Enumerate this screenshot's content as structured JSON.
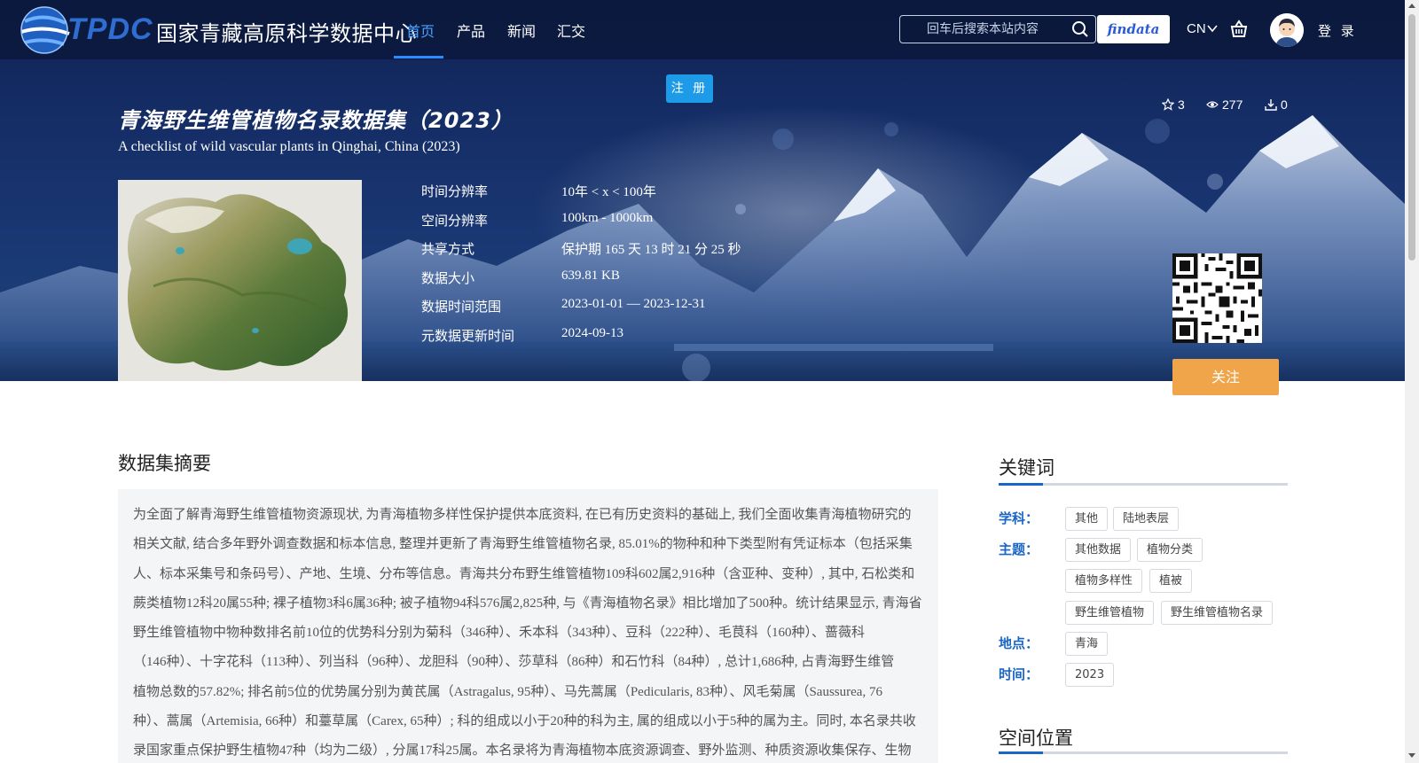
{
  "header": {
    "logo_text": "TPDC",
    "logo_cn": "国家青藏高原科学数据中心",
    "nav": [
      {
        "label": "首页",
        "active": true
      },
      {
        "label": "产品",
        "active": false
      },
      {
        "label": "新闻",
        "active": false
      },
      {
        "label": "汇交",
        "active": false
      }
    ],
    "search_placeholder": "回车后搜索本站内容",
    "findata_label": "findata",
    "lang_label": "CN",
    "login_label": "登 录",
    "register_label": "注 册"
  },
  "dataset": {
    "title": "青海野生维管植物名录数据集（2023）",
    "subtitle": "A checklist of wild vascular plants in Qinghai, China (2023)",
    "stats": {
      "stars": "3",
      "views": "277",
      "downloads": "0"
    },
    "meta": [
      {
        "label": "时间分辨率",
        "value": "10年 < x < 100年"
      },
      {
        "label": "空间分辨率",
        "value": "100km - 1000km"
      },
      {
        "label": "共享方式",
        "value": "保护期 165 天 13 时 21 分 25 秒"
      },
      {
        "label": "数据大小",
        "value": "639.81 KB"
      },
      {
        "label": "数据时间范围",
        "value": "2023-01-01 — 2023-12-31"
      },
      {
        "label": "元数据更新时间",
        "value": "2024-09-13"
      }
    ],
    "follow_label": "关注"
  },
  "abstract": {
    "heading": "数据集摘要",
    "lines": [
      "为全面了解青海野生维管植物资源现状, 为青海植物多样性保护提供本底资料, 在已有历史资料的基础上, 我们全面收集青海植物研究的",
      "相关文献, 结合多年野外调查数据和标本信息, 整理并更新了青海野生维管植物名录, 85.01%的物种和种下类型附有凭证标本（包括采集",
      "人、标本采集号和条码号）、产地、生境、分布等信息。青海共分布野生维管植物109科602属2,916种（含亚种、变种）, 其中, 石松类和",
      "蕨类植物12科20属55种; 裸子植物3科6属36种; 被子植物94科576属2,825种, 与《青海植物名录》相比增加了500种。统计结果显示, 青海省",
      "野生维管植物中物种数排名前10位的优势科分别为菊科（346种）、禾本科（343种）、豆科（222种）、毛茛科（160种）、蔷薇科",
      "（146种）、十字花科（113种）、列当科（96种）、龙胆科（90种）、莎草科（86种）和石竹科（84种）, 总计1,686种, 占青海野生维管",
      "植物总数的57.82%; 排名前5位的优势属分别为黄芪属（Astragalus, 95种）、马先蒿属（Pedicularis, 83种）、风毛菊属（Saussurea, 76",
      "种）、蒿属（Artemisia, 66种）和薹草属（Carex, 65种）; 科的组成以小于20种的科为主, 属的组成以小于5种的属为主。同时, 本名录共收",
      "录国家重点保护野生植物47种（均为二级）, 分属17科25属。本名录将为青海植物本底资源调查、野外监测、种质资源收集保存、生物"
    ]
  },
  "keywords": {
    "heading": "关键词",
    "subject_label": "学科：",
    "subject_tags": [
      "其他",
      "陆地表层"
    ],
    "topic_label": "主题：",
    "topic_tags": [
      "其他数据",
      "植物分类",
      "植物多样性",
      "植被",
      "野生维管植物",
      "野生维管植物名录"
    ],
    "place_label": "地点：",
    "place_tags": [
      "青海"
    ],
    "time_label": "时间：",
    "time_tags": [
      "2023"
    ]
  },
  "spatial": {
    "heading": "空间位置"
  },
  "colors": {
    "accent": "#1a66c6",
    "nav_active": "#4aa3ff",
    "follow": "#f0a54b",
    "register": "#1e9be8"
  }
}
